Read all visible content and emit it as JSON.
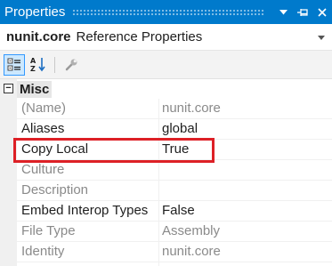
{
  "window": {
    "title": "Properties",
    "buttons": [
      {
        "icon": "dropdown-arrow-icon",
        "glyph": "▼"
      },
      {
        "icon": "pin-icon",
        "glyph": "⊣"
      },
      {
        "icon": "close-icon",
        "glyph": "✕"
      }
    ]
  },
  "object_selector": {
    "name": "nunit.core",
    "type": "Reference Properties"
  },
  "toolbar": {
    "buttons": [
      {
        "icon": "categorized-icon",
        "active": true
      },
      {
        "icon": "alphabetical-sort-icon",
        "active": false
      },
      {
        "icon": "wrench-icon",
        "active": false
      }
    ]
  },
  "category": {
    "label": "Misc",
    "toggle": "−"
  },
  "properties": [
    {
      "name": "(Name)",
      "value": "nunit.core",
      "readonly": true
    },
    {
      "name": "Aliases",
      "value": "global",
      "readonly": false
    },
    {
      "name": "Copy Local",
      "value": "True",
      "readonly": false,
      "highlighted": true
    },
    {
      "name": "Culture",
      "value": "",
      "readonly": true
    },
    {
      "name": "Description",
      "value": "",
      "readonly": true
    },
    {
      "name": "Embed Interop Types",
      "value": "False",
      "readonly": false
    },
    {
      "name": "File Type",
      "value": "Assembly",
      "readonly": true
    },
    {
      "name": "Identity",
      "value": "nunit.core",
      "readonly": true
    }
  ],
  "colors": {
    "titlebar": "#007acc",
    "highlight_border": "#dd2026",
    "readonly_text": "#8a8a8a"
  }
}
